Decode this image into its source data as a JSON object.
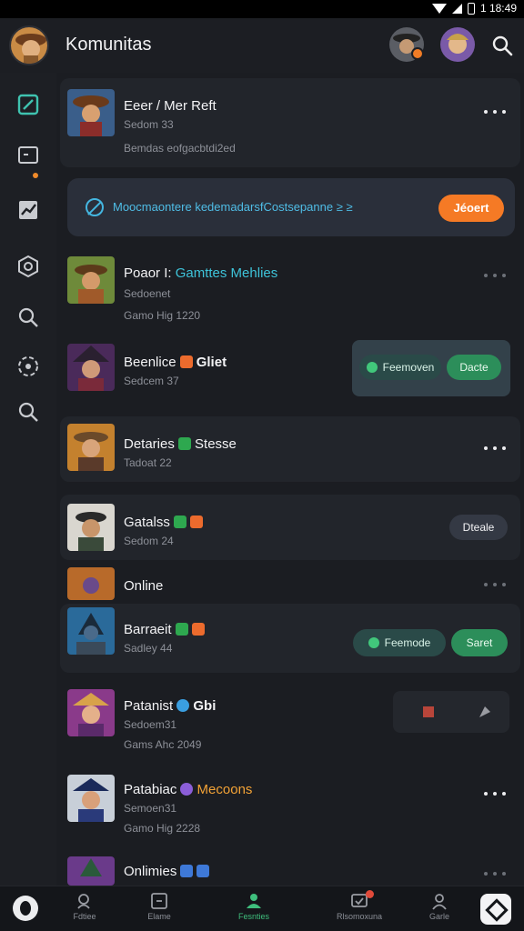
{
  "status_bar": {
    "time": "1 18:49"
  },
  "header": {
    "title": "Komunitas",
    "icons": [
      "user-avatar",
      "friend-avatar",
      "notification-badge",
      "search-icon"
    ]
  },
  "sidebar": {
    "icons": [
      "edit-icon",
      "chat-icon",
      "chart-icon",
      "hexagon-icon",
      "search-icon",
      "target-icon",
      "search-icon"
    ]
  },
  "banner": {
    "text": "Moocmaontere kedemadarsfCostsepanne ≥ ≥",
    "button": "Jéoert"
  },
  "rows": [
    {
      "name": "Eeer / Mer Reft",
      "sub1": "Sedom 33",
      "sub2": "Bemdas eofgacbtdi2ed"
    },
    {
      "name": "Poaor I: ",
      "name_accent": "Gamttes Mehlies",
      "sub1": "Sedoenet",
      "sub2": "Gamo Hig 1220"
    },
    {
      "name": "Beenlice",
      "name_accent": "Gliet",
      "sub1": "Sedcem 37"
    },
    {
      "name": "Detaries",
      "name_accent": "Stesse",
      "sub1": "Tadoat 22"
    },
    {
      "name": "Gatalss",
      "sub1": "Sedom 24"
    },
    {
      "name": "Online"
    },
    {
      "name": "Barraeit",
      "sub1": "Sadley 44"
    },
    {
      "name": "Patanist",
      "name_accent": "Gbi",
      "sub1": "Sedoem31",
      "sub2": "Gams Ahc 2049"
    },
    {
      "name": "Patabiac",
      "name_accent": "Mecoons",
      "sub1": "Semoen31",
      "sub2": "Gamo Hig 2228"
    },
    {
      "name": "Onlimies"
    }
  ],
  "actions": {
    "row3_secondary": "Feemoven",
    "row3_primary": "Dacte",
    "row5_button": "Dteale",
    "row7_secondary": "Feemode",
    "row7_primary": "Saret"
  },
  "bottom_nav": [
    {
      "label": "Fdtiee",
      "icon": "search-user-icon"
    },
    {
      "label": "Elame",
      "icon": "grid-icon"
    },
    {
      "label": "Fesnties",
      "icon": "community-icon",
      "active": true
    },
    {
      "label": "Rlsomoxuna",
      "icon": "message-icon"
    },
    {
      "label": "Garle",
      "icon": "profile-icon"
    }
  ],
  "colors": {
    "background": "#1b1d22",
    "accent_orange": "#f57a25",
    "accent_green": "#2c8e5a",
    "accent_cyan": "#3ec3d9"
  }
}
